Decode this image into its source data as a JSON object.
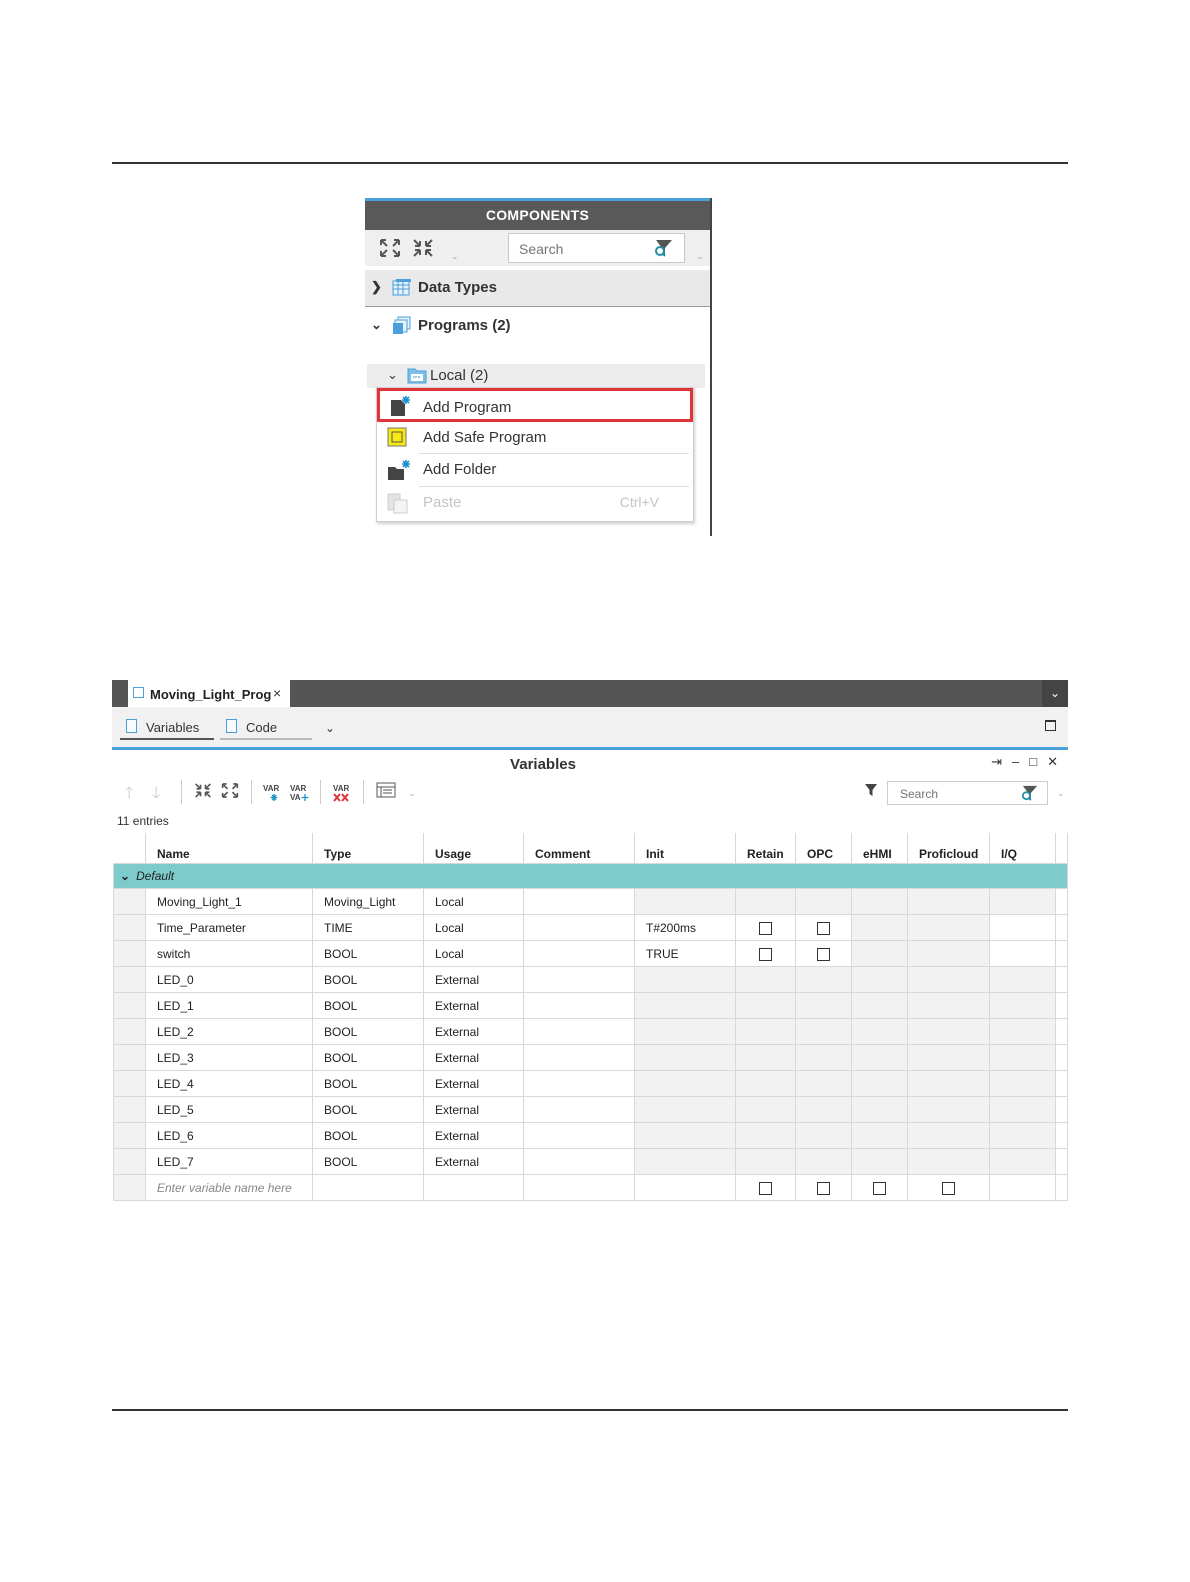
{
  "components": {
    "title": "COMPONENTS",
    "search_placeholder": "Search",
    "tree": {
      "data_types": "Data Types",
      "programs": "Programs (2)",
      "local": "Local (2)"
    },
    "context_menu": {
      "add_program": "Add Program",
      "add_safe_program": "Add Safe Program",
      "add_folder": "Add Folder",
      "paste": "Paste",
      "paste_shortcut": "Ctrl+V"
    }
  },
  "editor": {
    "tab_title": "Moving_Light_Prog",
    "tab_close": "×",
    "subtabs": {
      "variables": "Variables",
      "code": "Code"
    },
    "panel_title": "Variables",
    "search_placeholder": "Search",
    "entries": "11 entries",
    "columns": [
      "Name",
      "Type",
      "Usage",
      "Comment",
      "Init",
      "Retain",
      "OPC",
      "eHMI",
      "Proficloud",
      "I/Q"
    ],
    "group": "Default",
    "rows": [
      {
        "name": "Moving_Light_1",
        "type": "Moving_Light",
        "usage": "Local",
        "init": "",
        "retain": false,
        "opc": false
      },
      {
        "name": "Time_Parameter",
        "type": "TIME",
        "usage": "Local",
        "init": "T#200ms",
        "retain": true,
        "opc": true
      },
      {
        "name": "switch",
        "type": "BOOL",
        "usage": "Local",
        "init": "TRUE",
        "retain": true,
        "opc": true
      },
      {
        "name": "LED_0",
        "type": "BOOL",
        "usage": "External",
        "init": "",
        "retain": false,
        "opc": false
      },
      {
        "name": "LED_1",
        "type": "BOOL",
        "usage": "External",
        "init": "",
        "retain": false,
        "opc": false
      },
      {
        "name": "LED_2",
        "type": "BOOL",
        "usage": "External",
        "init": "",
        "retain": false,
        "opc": false
      },
      {
        "name": "LED_3",
        "type": "BOOL",
        "usage": "External",
        "init": "",
        "retain": false,
        "opc": false
      },
      {
        "name": "LED_4",
        "type": "BOOL",
        "usage": "External",
        "init": "",
        "retain": false,
        "opc": false
      },
      {
        "name": "LED_5",
        "type": "BOOL",
        "usage": "External",
        "init": "",
        "retain": false,
        "opc": false
      },
      {
        "name": "LED_6",
        "type": "BOOL",
        "usage": "External",
        "init": "",
        "retain": false,
        "opc": false
      },
      {
        "name": "LED_7",
        "type": "BOOL",
        "usage": "External",
        "init": "",
        "retain": false,
        "opc": false
      }
    ],
    "new_row_placeholder": "Enter variable name here"
  },
  "colors": {
    "accent": "#4aa0d8",
    "group_row": "#7ecbcc",
    "highlight": "#e2333a",
    "header_dark": "#595959"
  }
}
